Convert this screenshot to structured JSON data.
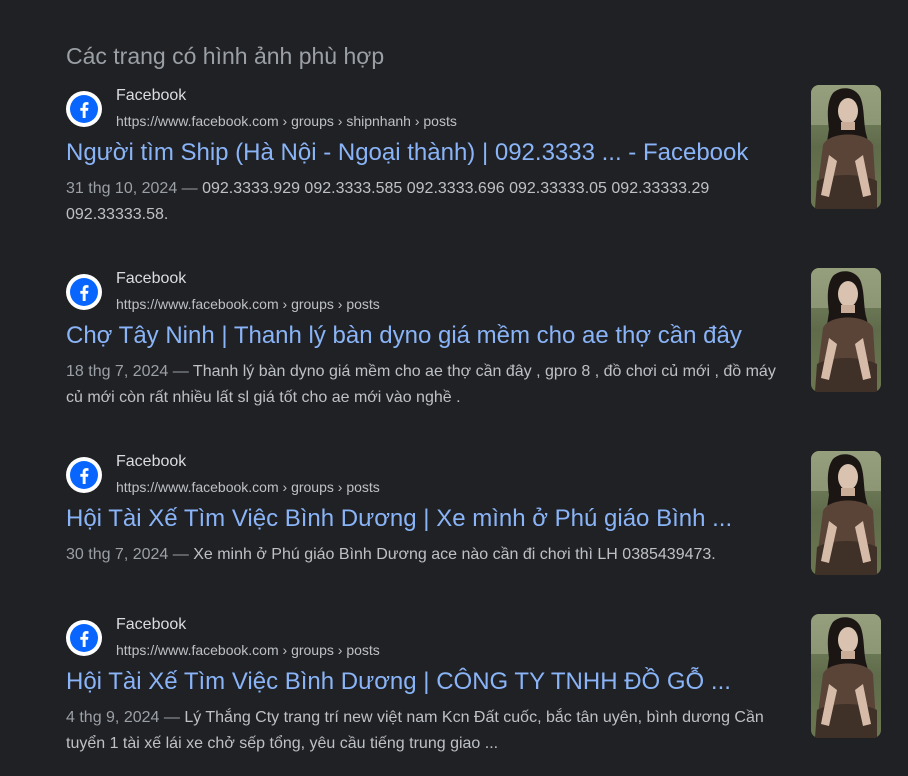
{
  "section_title": "Các trang có hình ảnh phù hợp",
  "results": [
    {
      "site_name": "Facebook",
      "url": "https://www.facebook.com › groups › shipnhanh › posts",
      "title": "Người tìm Ship (Hà Nội - Ngoại thành) | 092.3333 ... - Facebook",
      "date": "31 thg 10, 2024 — ",
      "snippet": "092.3333.929 092.3333.585 092.3333.696 092.33333.05 092.33333.29 092.33333.58."
    },
    {
      "site_name": "Facebook",
      "url": "https://www.facebook.com › groups › posts",
      "title": "Chợ Tây Ninh | Thanh lý bàn dyno giá mềm cho ae thợ cần đây",
      "date": "18 thg 7, 2024 — ",
      "snippet": "Thanh lý bàn dyno giá mềm cho ae thợ cần đây , gpro 8 , đồ chơi củ mới , đồ máy củ mới còn rất nhiều lất sl giá tốt cho ae mới vào nghề ."
    },
    {
      "site_name": "Facebook",
      "url": "https://www.facebook.com › groups › posts",
      "title": "Hội Tài Xế Tìm Việc Bình Dương | Xe mình ở Phú giáo Bình ...",
      "date": "30 thg 7, 2024 — ",
      "snippet": "Xe minh ở Phú giáo Bình Dương ace nào cần đi chơi thì LH 0385439473."
    },
    {
      "site_name": "Facebook",
      "url": "https://www.facebook.com › groups › posts",
      "title": "Hội Tài Xế Tìm Việc Bình Dương | CÔNG TY TNHH ĐỒ GỖ ...",
      "date": "4 thg 9, 2024 — ",
      "snippet": "Lý Thắng Cty trang trí new việt nam Kcn Đất cuốc, bắc tân uyên, bình dương Cần tuyển 1 tài xế lái xe chở sếp tổng, yêu cầu tiếng trung giao ..."
    }
  ],
  "icons": {
    "favicon": "facebook-icon",
    "thumbnail": "matching-image-thumbnail"
  },
  "colors": {
    "background": "#202124",
    "link": "#8ab4f8",
    "text": "#bdc1c6",
    "muted": "#9aa0a6",
    "facebook_blue": "#0866ff"
  }
}
